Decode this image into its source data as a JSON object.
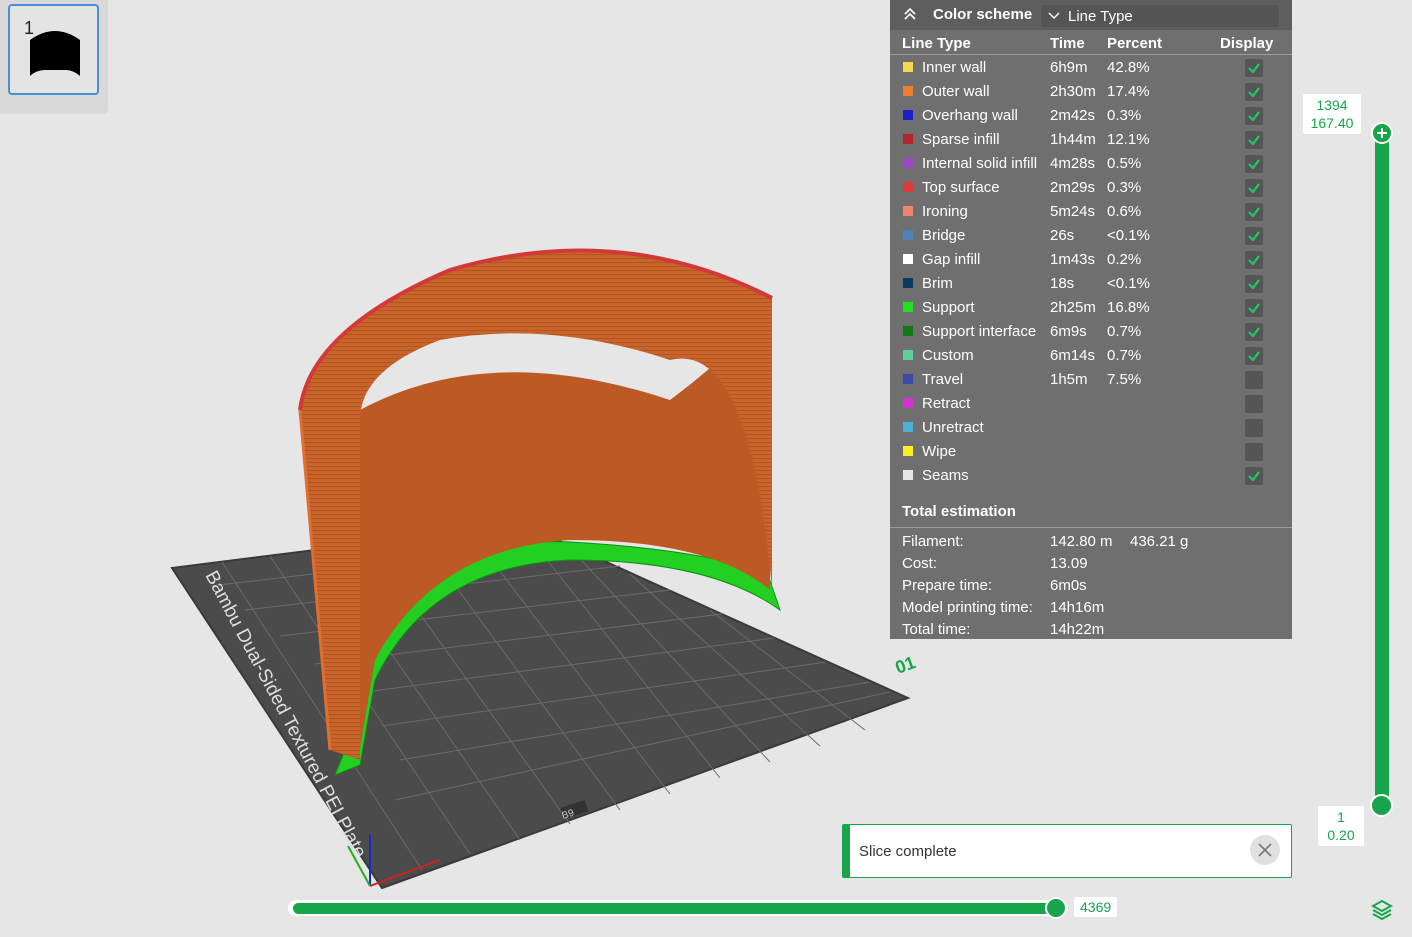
{
  "plate_thumbnail": {
    "number": "1"
  },
  "bed": {
    "label": "Bambu Dual-Sided Textured PEI Plate",
    "plate_number": "01",
    "plate_code": "B9"
  },
  "legend": {
    "scheme_label": "Color scheme",
    "scheme_value": "Line Type",
    "columns": {
      "type": "Line Type",
      "time": "Time",
      "percent": "Percent",
      "display": "Display"
    },
    "rows": [
      {
        "name": "Inner wall",
        "color": "#f3d84e",
        "time": "6h9m",
        "percent": "42.8%",
        "display": true
      },
      {
        "name": "Outer wall",
        "color": "#f07c2e",
        "time": "2h30m",
        "percent": "17.4%",
        "display": true
      },
      {
        "name": "Overhang wall",
        "color": "#1e1ec8",
        "time": "2m42s",
        "percent": "0.3%",
        "display": true
      },
      {
        "name": "Sparse infill",
        "color": "#b0262a",
        "time": "1h44m",
        "percent": "12.1%",
        "display": true
      },
      {
        "name": "Internal solid infill",
        "color": "#9a46c8",
        "time": "4m28s",
        "percent": "0.5%",
        "display": true
      },
      {
        "name": "Top surface",
        "color": "#de3c3c",
        "time": "2m29s",
        "percent": "0.3%",
        "display": true
      },
      {
        "name": "Ironing",
        "color": "#f0866c",
        "time": "5m24s",
        "percent": "0.6%",
        "display": true
      },
      {
        "name": "Bridge",
        "color": "#4e82bc",
        "time": "26s",
        "percent": "<0.1%",
        "display": true
      },
      {
        "name": "Gap infill",
        "color": "#ffffff",
        "time": "1m43s",
        "percent": "0.2%",
        "display": true
      },
      {
        "name": "Brim",
        "color": "#0c3a5c",
        "time": "18s",
        "percent": "<0.1%",
        "display": true
      },
      {
        "name": "Support",
        "color": "#1ee01e",
        "time": "2h25m",
        "percent": "16.8%",
        "display": true
      },
      {
        "name": "Support interface",
        "color": "#127812",
        "time": "6m9s",
        "percent": "0.7%",
        "display": true
      },
      {
        "name": "Custom",
        "color": "#5ecf9a",
        "time": "6m14s",
        "percent": "0.7%",
        "display": true
      },
      {
        "name": "Travel",
        "color": "#3c4aa6",
        "time": "1h5m",
        "percent": "7.5%",
        "display": false
      },
      {
        "name": "Retract",
        "color": "#d034d0",
        "time": "",
        "percent": "",
        "display": false
      },
      {
        "name": "Unretract",
        "color": "#4cb0d6",
        "time": "",
        "percent": "",
        "display": false
      },
      {
        "name": "Wipe",
        "color": "#f8f020",
        "time": "",
        "percent": "",
        "display": false
      },
      {
        "name": "Seams",
        "color": "#e6e6e6",
        "time": "",
        "percent": "",
        "display": true
      }
    ],
    "total_title": "Total estimation",
    "summary": [
      {
        "label": "Filament:",
        "value": "142.80 m",
        "value2": "436.21 g"
      },
      {
        "label": "Cost:",
        "value": "13.09",
        "value2": ""
      },
      {
        "label": "Prepare time:",
        "value": "6m0s",
        "value2": ""
      },
      {
        "label": "Model printing time:",
        "value": "14h16m",
        "value2": ""
      },
      {
        "label": "Total time:",
        "value": "14h22m",
        "value2": ""
      }
    ]
  },
  "layer_slider": {
    "top_layer": "1394",
    "top_height": "167.40",
    "bottom_layer": "1",
    "bottom_height": "0.20"
  },
  "move_slider": {
    "value": "4369",
    "fraction": 0.97
  },
  "notification": {
    "text": "Slice complete"
  },
  "colors": {
    "accent": "#16a54a",
    "panel": "#6f6f6f",
    "bed": "#4b4b4b",
    "wall": "#c8642a"
  },
  "icons": [
    "collapse-icon",
    "chevron-down-icon",
    "check-icon",
    "close-icon",
    "layers-icon"
  ]
}
